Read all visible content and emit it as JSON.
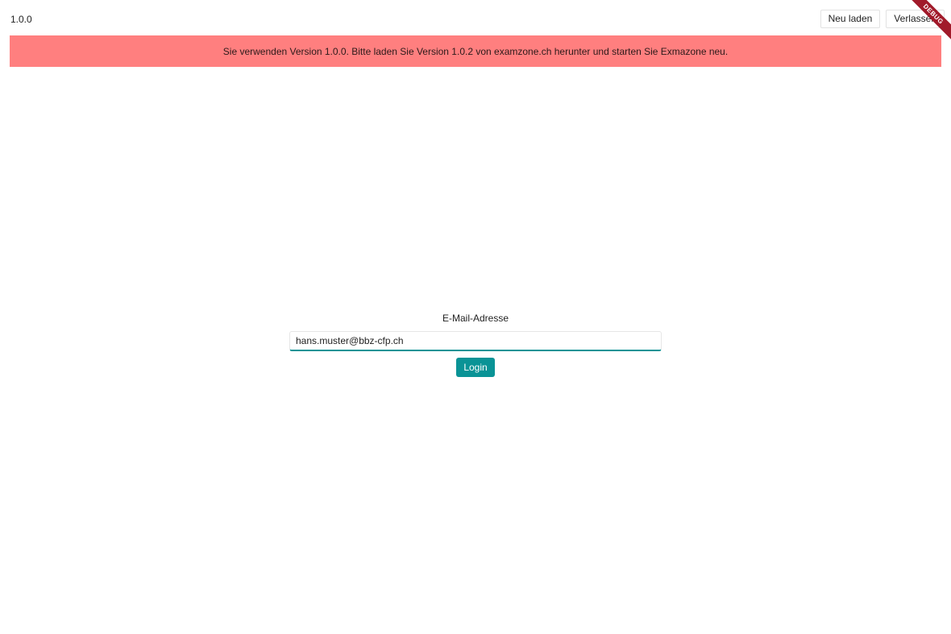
{
  "app": {
    "version": "1.0.0"
  },
  "toolbar": {
    "reload_label": "Neu laden",
    "exit_label": "Verlassen"
  },
  "banner": {
    "message": "Sie verwenden Version 1.0.0. Bitte laden Sie Version 1.0.2 von examzone.ch herunter und starten Sie Exmazone neu.",
    "color": "#ff7f7f"
  },
  "debug_ribbon": {
    "label": "DEBUG"
  },
  "login": {
    "email_label": "E-Mail-Adresse",
    "email_value": "hans.muster@bbz-cfp.ch",
    "button_label": "Login",
    "accent_color": "#0a9396"
  }
}
